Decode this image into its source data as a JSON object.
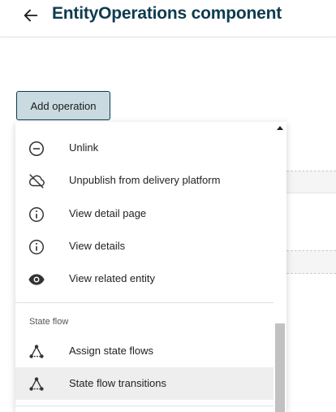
{
  "header": {
    "title": "EntityOperations component"
  },
  "toolbar": {
    "add_operation_label": "Add operation"
  },
  "menu": {
    "items": [
      {
        "label": "Unlink",
        "icon": "minus-circle-icon"
      },
      {
        "label": "Unpublish from delivery platform",
        "icon": "cloud-off-icon"
      },
      {
        "label": "View detail page",
        "icon": "info-circle-icon"
      },
      {
        "label": "View details",
        "icon": "info-circle-icon"
      },
      {
        "label": "View related entity",
        "icon": "eye-icon"
      }
    ],
    "section_state_flow": "State flow",
    "state_flow_items": [
      {
        "label": "Assign state flows",
        "icon": "state-flow-icon"
      },
      {
        "label": "State flow transitions",
        "icon": "state-flow-icon",
        "hovered": true
      }
    ]
  },
  "colors": {
    "title": "#0e3b4f",
    "button_bg": "#c9dbe0",
    "button_border": "#0e3b4f",
    "hover_bg": "#eeeeee"
  }
}
